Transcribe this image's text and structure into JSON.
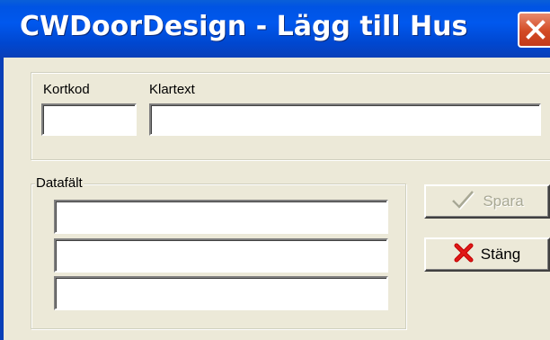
{
  "window": {
    "title": "CWDoorDesign - Lägg till Hus",
    "close_icon": "close-x-icon",
    "accent_color": "#0054e3",
    "close_color": "#d34a24"
  },
  "top_group": {
    "kortkod_label": "Kortkod",
    "kortkod_value": "",
    "klartext_label": "Klartext",
    "klartext_value": ""
  },
  "data_group": {
    "label": "Datafält",
    "fields": [
      "",
      "",
      ""
    ]
  },
  "buttons": {
    "save": {
      "label": "Spara",
      "icon": "checkmark-icon",
      "enabled": false
    },
    "close": {
      "label": "Stäng",
      "icon": "red-x-icon",
      "enabled": true
    }
  }
}
